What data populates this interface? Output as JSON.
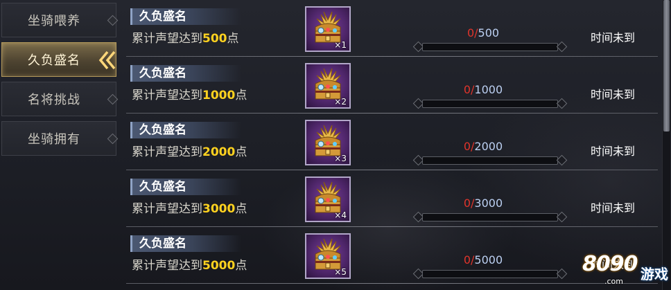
{
  "sidebar": {
    "tabs": [
      {
        "label": "坐骑喂养",
        "active": false
      },
      {
        "label": "久负盛名",
        "active": true
      },
      {
        "label": "名将挑战",
        "active": false
      },
      {
        "label": "坐骑拥有",
        "active": false
      }
    ]
  },
  "achievements": [
    {
      "title": "久负盛名",
      "desc_prefix": "累计声望达到",
      "target": "500",
      "desc_suffix": "点",
      "reward_qty": "×1",
      "current": "0",
      "separator": "/",
      "total": "500",
      "progress": 0,
      "status": "时间未到"
    },
    {
      "title": "久负盛名",
      "desc_prefix": "累计声望达到",
      "target": "1000",
      "desc_suffix": "点",
      "reward_qty": "×2",
      "current": "0",
      "separator": "/",
      "total": "1000",
      "progress": 0,
      "status": "时间未到"
    },
    {
      "title": "久负盛名",
      "desc_prefix": "累计声望达到",
      "target": "2000",
      "desc_suffix": "点",
      "reward_qty": "×3",
      "current": "0",
      "separator": "/",
      "total": "2000",
      "progress": 0,
      "status": "时间未到"
    },
    {
      "title": "久负盛名",
      "desc_prefix": "累计声望达到",
      "target": "3000",
      "desc_suffix": "点",
      "reward_qty": "×4",
      "current": "0",
      "separator": "/",
      "total": "3000",
      "progress": 0,
      "status": "时间未到"
    },
    {
      "title": "久负盛名",
      "desc_prefix": "累计声望达到",
      "target": "5000",
      "desc_suffix": "点",
      "reward_qty": "×5",
      "current": "0",
      "separator": "/",
      "total": "5000",
      "progress": 0,
      "status": "时间未到"
    }
  ],
  "watermark": {
    "number": "8090",
    "text": "游戏",
    "url": ".com"
  },
  "icons": {
    "reward": "treasure-chest-icon",
    "active_tab": "double-chevron-left-icon"
  },
  "colors": {
    "highlight": "#ffd21f",
    "current_value": "#e0342b",
    "total_value": "#bcd0f2",
    "active_tab_border": "#b59a5b"
  }
}
